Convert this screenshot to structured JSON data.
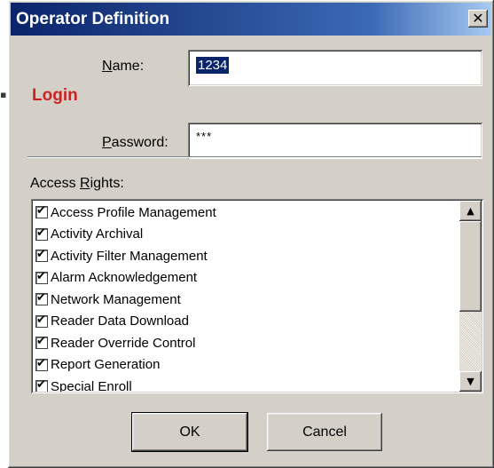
{
  "window": {
    "title": "Operator Definition",
    "close_icon": "close-icon",
    "close_glyph": "✕"
  },
  "login": {
    "label": "Login",
    "color": "#cc2222"
  },
  "name_field": {
    "label_first": "N",
    "label_rest": "ame:",
    "value": "1234"
  },
  "password_field": {
    "label_first": "P",
    "label_rest": "assword:",
    "value": "***"
  },
  "access_rights": {
    "label_before": "Access ",
    "label_underlined": "R",
    "label_after": "ights:",
    "items": [
      {
        "label": "Access Profile Management",
        "checked": true
      },
      {
        "label": "Activity Archival",
        "checked": true
      },
      {
        "label": "Activity Filter Management",
        "checked": true
      },
      {
        "label": "Alarm Acknowledgement",
        "checked": true
      },
      {
        "label": "Network Management",
        "checked": true
      },
      {
        "label": "Reader Data Download",
        "checked": true
      },
      {
        "label": "Reader Override Control",
        "checked": true
      },
      {
        "label": "Report Generation",
        "checked": true
      },
      {
        "label": "Special Enroll",
        "checked": true
      }
    ],
    "scroll_up_glyph": "▲",
    "scroll_down_glyph": "▼"
  },
  "buttons": {
    "ok_label": "OK",
    "cancel_label": "Cancel"
  },
  "colors": {
    "titlebar_start": "#0a246a",
    "titlebar_end": "#a6caf0",
    "dialog_face": "#d4d0c8",
    "selection": "#0a246a"
  }
}
